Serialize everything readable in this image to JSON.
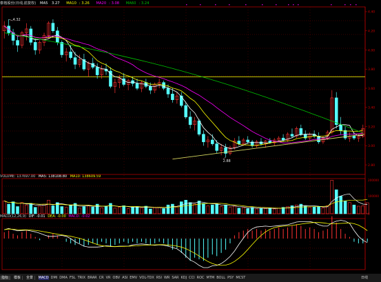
{
  "header": {
    "name": "泰格股份(日线,前复权)",
    "ma5_label": "MA5",
    "ma5_value": "3.27",
    "ma10_label": "MA10",
    "ma10_value": "3.26",
    "ma20_label": "MA20",
    "ma20_value": "3.08",
    "ma60_label": "MA60",
    "ma60_value": "3.24"
  },
  "price_panel": {
    "high_label": "4.32",
    "low_label": "2.88",
    "horizontal_line_color": "#c8c800",
    "support_line_color": "#d8d860"
  },
  "volume_header": {
    "label": "VOLUME",
    "value": "137697.00",
    "ma5_label": "MA5",
    "ma5_value": "138108.80",
    "ma10_label": "MA10",
    "ma10_value": "138609.59"
  },
  "macd_header": {
    "label": "MACD(12,26,9)",
    "dif_label": "DIF",
    "dif_value": "-0.01",
    "dea_label": "DEA",
    "dea_value": "-0.00",
    "macd_label": "MACD",
    "macd_value": "-0.02"
  },
  "colors": {
    "up": "#ff3232",
    "down": "#54fcfc",
    "ma5": "#ffffff",
    "ma10": "#ffff00",
    "ma20": "#ff00ff",
    "ma60": "#00c000",
    "grid": "#7a0000",
    "axis": "#b00000"
  },
  "bottom_bar": {
    "tabs": [
      "指标",
      "模板",
      "全景"
    ],
    "indicators": [
      "MACD",
      "DMI",
      "DMA",
      "FSL",
      "TRIX",
      "BRAR",
      "CR",
      "VR",
      "OBV",
      "ASI",
      "EMV",
      "VOL-TDX",
      "RSI",
      "WR",
      "SAR",
      "KDJ",
      "CCI",
      "ROC",
      "MTM",
      "BOLL",
      "PSY",
      "MCST"
    ],
    "active_indicator": "MACD",
    "period": "日线"
  },
  "chart_data": [
    {
      "type": "candlestick",
      "title": "泰格股份(日线,前复权)",
      "annotations": [
        {
          "text": "4.32",
          "value": 4.32
        },
        {
          "text": "2.88",
          "value": 2.88
        }
      ],
      "series": [
        {
          "name": "MA5",
          "value": 3.27
        },
        {
          "name": "MA10",
          "value": 3.26
        },
        {
          "name": "MA20",
          "value": 3.08
        },
        {
          "name": "MA60",
          "value": 3.24
        }
      ],
      "ohlc": [
        [
          4.2,
          4.3,
          4.12,
          4.25
        ],
        [
          4.25,
          4.32,
          4.15,
          4.18
        ],
        [
          4.18,
          4.22,
          4.05,
          4.1
        ],
        [
          4.1,
          4.15,
          3.98,
          4.05
        ],
        [
          4.05,
          4.2,
          4.02,
          4.18
        ],
        [
          4.18,
          4.28,
          4.1,
          4.22
        ],
        [
          4.22,
          4.25,
          4.05,
          4.08
        ],
        [
          4.08,
          4.12,
          3.95,
          4.0
        ],
        [
          4.0,
          4.1,
          3.96,
          4.08
        ],
        [
          4.08,
          4.18,
          4.04,
          4.15
        ],
        [
          4.15,
          4.3,
          4.12,
          4.28
        ],
        [
          4.28,
          4.32,
          4.18,
          4.2
        ],
        [
          4.2,
          4.24,
          4.05,
          4.08
        ],
        [
          4.08,
          4.1,
          3.92,
          3.95
        ],
        [
          3.95,
          4.02,
          3.88,
          3.98
        ],
        [
          3.98,
          4.05,
          3.9,
          3.92
        ],
        [
          3.92,
          3.98,
          3.8,
          3.85
        ],
        [
          3.85,
          3.95,
          3.82,
          3.9
        ],
        [
          3.9,
          3.96,
          3.78,
          3.8
        ],
        [
          3.8,
          3.88,
          3.72,
          3.86
        ],
        [
          3.86,
          3.92,
          3.8,
          3.82
        ],
        [
          3.82,
          3.86,
          3.7,
          3.74
        ],
        [
          3.74,
          3.84,
          3.7,
          3.8
        ],
        [
          3.8,
          3.86,
          3.74,
          3.78
        ],
        [
          3.78,
          3.82,
          3.6,
          3.62
        ],
        [
          3.62,
          3.7,
          3.55,
          3.66
        ],
        [
          3.66,
          3.74,
          3.6,
          3.7
        ],
        [
          3.7,
          3.76,
          3.62,
          3.64
        ],
        [
          3.64,
          3.7,
          3.58,
          3.68
        ],
        [
          3.68,
          3.72,
          3.62,
          3.65
        ],
        [
          3.65,
          3.7,
          3.58,
          3.6
        ],
        [
          3.6,
          3.68,
          3.56,
          3.66
        ],
        [
          3.66,
          3.7,
          3.6,
          3.62
        ],
        [
          3.62,
          3.66,
          3.54,
          3.58
        ],
        [
          3.58,
          3.66,
          3.55,
          3.64
        ],
        [
          3.64,
          3.7,
          3.6,
          3.66
        ],
        [
          3.66,
          3.68,
          3.58,
          3.6
        ],
        [
          3.6,
          3.64,
          3.5,
          3.54
        ],
        [
          3.54,
          3.6,
          3.45,
          3.48
        ],
        [
          3.48,
          3.56,
          3.44,
          3.52
        ],
        [
          3.52,
          3.56,
          3.4,
          3.42
        ],
        [
          3.42,
          3.46,
          3.28,
          3.3
        ],
        [
          3.3,
          3.36,
          3.18,
          3.22
        ],
        [
          3.22,
          3.3,
          3.16,
          3.26
        ],
        [
          3.26,
          3.28,
          3.1,
          3.12
        ],
        [
          3.12,
          3.16,
          3.0,
          3.04
        ],
        [
          3.04,
          3.1,
          2.98,
          3.06
        ],
        [
          3.06,
          3.12,
          3.0,
          3.02
        ],
        [
          3.02,
          3.06,
          2.92,
          2.95
        ],
        [
          2.95,
          3.02,
          2.9,
          2.98
        ],
        [
          2.98,
          3.02,
          2.88,
          2.92
        ],
        [
          2.92,
          3.0,
          2.9,
          2.98
        ],
        [
          2.98,
          3.08,
          2.96,
          3.05
        ],
        [
          3.05,
          3.1,
          3.0,
          3.02
        ],
        [
          3.02,
          3.08,
          3.0,
          3.06
        ],
        [
          3.06,
          3.1,
          3.02,
          3.04
        ],
        [
          3.04,
          3.06,
          2.98,
          3.0
        ],
        [
          3.0,
          3.06,
          2.98,
          3.04
        ],
        [
          3.04,
          3.08,
          3.0,
          3.02
        ],
        [
          3.02,
          3.06,
          2.98,
          3.05
        ],
        [
          3.05,
          3.08,
          3.02,
          3.03
        ],
        [
          3.03,
          3.08,
          3.0,
          3.06
        ],
        [
          3.06,
          3.1,
          3.04,
          3.08
        ],
        [
          3.08,
          3.12,
          3.04,
          3.06
        ],
        [
          3.06,
          3.14,
          3.04,
          3.12
        ],
        [
          3.12,
          3.18,
          3.08,
          3.1
        ],
        [
          3.1,
          3.2,
          3.08,
          3.18
        ],
        [
          3.18,
          3.22,
          3.1,
          3.12
        ],
        [
          3.12,
          3.16,
          3.06,
          3.08
        ],
        [
          3.08,
          3.14,
          3.06,
          3.12
        ],
        [
          3.12,
          3.16,
          3.08,
          3.1
        ],
        [
          3.1,
          3.14,
          3.02,
          3.04
        ],
        [
          3.04,
          3.1,
          3.02,
          3.08
        ],
        [
          3.08,
          3.16,
          3.06,
          3.14
        ],
        [
          3.14,
          3.58,
          3.12,
          3.5
        ],
        [
          3.5,
          3.56,
          3.18,
          3.22
        ],
        [
          3.22,
          3.3,
          3.12,
          3.16
        ],
        [
          3.16,
          3.2,
          3.06,
          3.08
        ],
        [
          3.08,
          3.14,
          3.04,
          3.1
        ],
        [
          3.1,
          3.14,
          3.06,
          3.08
        ],
        [
          3.08,
          3.12,
          3.04,
          3.1
        ],
        [
          3.1,
          3.22,
          3.08,
          3.18
        ]
      ]
    },
    {
      "type": "bar",
      "title": "VOLUME",
      "series": [
        {
          "name": "VOLUME",
          "value": 137697.0
        },
        {
          "name": "MA5",
          "value": 138108.8
        },
        {
          "name": "MA10",
          "value": 138609.59
        }
      ],
      "values": [
        160,
        120,
        150,
        90,
        140,
        110,
        130,
        80,
        95,
        120,
        170,
        100,
        140,
        90,
        80,
        110,
        130,
        70,
        90,
        100,
        85,
        120,
        75,
        95,
        130,
        70,
        80,
        100,
        65,
        85,
        90,
        70,
        95,
        60,
        75,
        80,
        65,
        110,
        120,
        90,
        150,
        170,
        140,
        120,
        160,
        130,
        100,
        110,
        120,
        90,
        110,
        80,
        95,
        70,
        75,
        65,
        80,
        60,
        70,
        65,
        75,
        60,
        70,
        80,
        90,
        100,
        110,
        120,
        95,
        80,
        85,
        90,
        75,
        100,
        420,
        300,
        220,
        160,
        140,
        110,
        95,
        100,
        137.7
      ]
    },
    {
      "type": "bar",
      "title": "MACD(12,26,9)",
      "series": [
        {
          "name": "DIF",
          "value": -0.01
        },
        {
          "name": "DEA",
          "value": -0.0
        },
        {
          "name": "MACD",
          "value": -0.02
        }
      ],
      "values": [
        0.04,
        0.05,
        0.03,
        0.02,
        0.04,
        0.05,
        0.03,
        0.01,
        -0.01,
        0.0,
        0.02,
        0.03,
        0.02,
        0.0,
        -0.02,
        -0.03,
        -0.04,
        -0.03,
        -0.05,
        -0.04,
        -0.03,
        -0.04,
        -0.02,
        -0.03,
        -0.05,
        -0.04,
        -0.03,
        -0.02,
        -0.03,
        -0.02,
        -0.03,
        -0.02,
        -0.03,
        -0.04,
        -0.03,
        -0.02,
        -0.03,
        -0.05,
        -0.07,
        -0.06,
        -0.09,
        -0.12,
        -0.14,
        -0.12,
        -0.13,
        -0.14,
        -0.12,
        -0.1,
        -0.11,
        -0.09,
        -0.07,
        -0.03,
        0.02,
        0.04,
        0.05,
        0.06,
        0.05,
        0.06,
        0.05,
        0.06,
        0.05,
        0.06,
        0.07,
        0.06,
        0.07,
        0.08,
        0.09,
        0.08,
        0.06,
        0.07,
        0.06,
        0.04,
        0.05,
        0.06,
        0.14,
        0.1,
        0.06,
        0.03,
        0.01,
        -0.02,
        -0.03,
        -0.03,
        -0.02
      ]
    }
  ]
}
